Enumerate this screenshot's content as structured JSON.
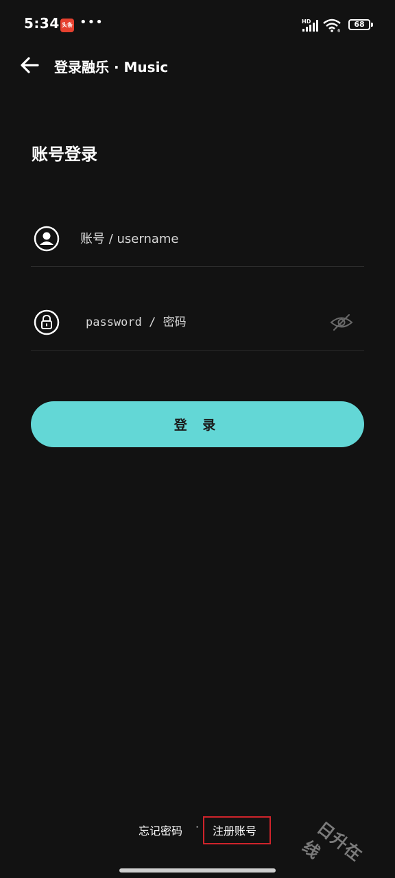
{
  "status_bar": {
    "time": "5:34",
    "app_badge": "头条",
    "more_dots": "•••",
    "network_label": "HD",
    "wifi_sub": "6",
    "battery": "68"
  },
  "header": {
    "title": "登录融乐 · Music"
  },
  "login": {
    "section_title": "账号登录",
    "username_placeholder": "账号 / username",
    "password_placeholder": "password / 密码",
    "submit_label": "登 录"
  },
  "footer": {
    "forgot_label": "忘记密码",
    "separator": "·",
    "register_label": "注册账号"
  },
  "watermark": "日升在线",
  "colors": {
    "background": "#121212",
    "accent": "#63d7d6",
    "highlight": "#d0242b"
  },
  "icons": [
    "back-arrow-icon",
    "user-icon",
    "lock-icon",
    "eye-off-icon",
    "wifi-icon",
    "signal-icon",
    "battery-icon"
  ]
}
